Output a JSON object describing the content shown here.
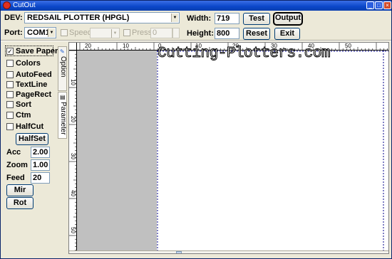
{
  "window": {
    "title": "CutOut"
  },
  "toolbar": {
    "dev_label": "DEV:",
    "dev_value": "REDSAIL PLOTTER  (HPGL)",
    "port_label": "Port:",
    "port_value": "COM1",
    "speed_label": "Speed",
    "pressure_label": "Press",
    "pressure_value": "0",
    "width_label": "Width:",
    "width_value": "719",
    "height_label": "Height:",
    "height_value": "800",
    "test_label": "Test",
    "output_label": "Output",
    "reset_label": "Reset",
    "exit_label": "Exit"
  },
  "options": {
    "items": [
      {
        "label": "Save Paper",
        "checked": true
      },
      {
        "label": "Colors",
        "checked": false
      },
      {
        "label": "AutoFeed",
        "checked": false
      },
      {
        "label": "TextLine",
        "checked": false
      },
      {
        "label": "PageRect",
        "checked": false
      },
      {
        "label": "Sort",
        "checked": false
      },
      {
        "label": "Ctm",
        "checked": false
      },
      {
        "label": "HalfCut",
        "checked": false
      }
    ],
    "halfset_label": "HalfSet",
    "acc_label": "Acc",
    "acc_value": "2.00",
    "zoom_label": "Zoom",
    "zoom_value": "1.00",
    "feed_label": "Feed",
    "feed_value": "20",
    "mir_label": "Mir",
    "rot_label": "Rot"
  },
  "tabs": {
    "option": "Option",
    "parameter": "Parameter"
  },
  "canvas": {
    "watermark": "Cutting-Plotters.com",
    "hruler_labels": [
      "20",
      "10",
      "0",
      "10",
      "20",
      "30",
      "40",
      "50"
    ],
    "vruler_labels": [
      "10",
      "20",
      "30",
      "40",
      "50"
    ]
  }
}
